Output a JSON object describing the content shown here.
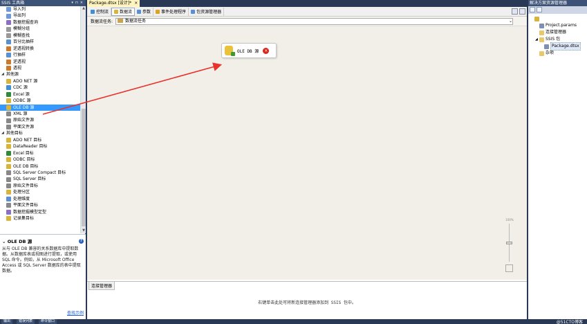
{
  "toolbox": {
    "title": "SSIS 工具箱",
    "items": [
      {
        "type": "item",
        "label": "导入列",
        "icon": "import-column-icon",
        "color": "#6d9bd8"
      },
      {
        "type": "item",
        "label": "导出列",
        "icon": "export-column-icon",
        "color": "#6d9bd8"
      },
      {
        "type": "item",
        "label": "数据挖掘查询",
        "icon": "data-mining-query-icon",
        "color": "#8c6fc0"
      },
      {
        "type": "item",
        "label": "模糊分组",
        "icon": "fuzzy-grouping-icon",
        "color": "#999999"
      },
      {
        "type": "item",
        "label": "模糊查找",
        "icon": "fuzzy-lookup-icon",
        "color": "#999999"
      },
      {
        "type": "item",
        "label": "百分比抽样",
        "icon": "percentage-sampling-icon",
        "color": "#5a8fd0"
      },
      {
        "type": "item",
        "label": "逆透视转换",
        "icon": "unpivot-icon",
        "color": "#cc7a2a"
      },
      {
        "type": "item",
        "label": "行抽样",
        "icon": "row-sampling-icon",
        "color": "#5a8fd0"
      },
      {
        "type": "item",
        "label": "逆透视",
        "icon": "unpivot-icon",
        "color": "#cc7a2a"
      },
      {
        "type": "item",
        "label": "透视",
        "icon": "pivot-icon",
        "color": "#cc7a2a"
      },
      {
        "type": "group",
        "label": "其他源"
      },
      {
        "type": "item",
        "label": "ADO NET 源",
        "icon": "ado-net-source-icon",
        "color": "#d9b43a"
      },
      {
        "type": "item",
        "label": "CDC 源",
        "icon": "cdc-source-icon",
        "color": "#3f8fd2"
      },
      {
        "type": "item",
        "label": "Excel 源",
        "icon": "excel-source-icon",
        "color": "#2f8a3a"
      },
      {
        "type": "item",
        "label": "ODBC 源",
        "icon": "odbc-source-icon",
        "color": "#d9b43a"
      },
      {
        "type": "item",
        "label": "OLE DB 源",
        "icon": "ole-db-source-icon",
        "color": "#d9b43a",
        "selected": true
      },
      {
        "type": "item",
        "label": "XML 源",
        "icon": "xml-source-icon",
        "color": "#888888"
      },
      {
        "type": "item",
        "label": "原始文件源",
        "icon": "raw-file-source-icon",
        "color": "#888888"
      },
      {
        "type": "item",
        "label": "平面文件源",
        "icon": "flat-file-source-icon",
        "color": "#888888"
      },
      {
        "type": "group",
        "label": "其他目标"
      },
      {
        "type": "item",
        "label": "ADO NET 目标",
        "icon": "ado-net-destination-icon",
        "color": "#d9b43a"
      },
      {
        "type": "item",
        "label": "DataReader 目标",
        "icon": "datareader-destination-icon",
        "color": "#d9b43a"
      },
      {
        "type": "item",
        "label": "Excel 目标",
        "icon": "excel-destination-icon",
        "color": "#2f8a3a"
      },
      {
        "type": "item",
        "label": "ODBC 目标",
        "icon": "odbc-destination-icon",
        "color": "#d9b43a"
      },
      {
        "type": "item",
        "label": "OLE DB 目标",
        "icon": "ole-db-destination-icon",
        "color": "#d9b43a"
      },
      {
        "type": "item",
        "label": "SQL Server Compact 目标",
        "icon": "sql-compact-destination-icon",
        "color": "#888888"
      },
      {
        "type": "item",
        "label": "SQL Server 目标",
        "icon": "sql-server-destination-icon",
        "color": "#888888"
      },
      {
        "type": "item",
        "label": "原始文件目标",
        "icon": "raw-file-destination-icon",
        "color": "#888888"
      },
      {
        "type": "item",
        "label": "处理分区",
        "icon": "partition-processing-icon",
        "color": "#d9b43a"
      },
      {
        "type": "item",
        "label": "处理维度",
        "icon": "dimension-processing-icon",
        "color": "#5a8fd0"
      },
      {
        "type": "item",
        "label": "平面文件目标",
        "icon": "flat-file-destination-icon",
        "color": "#888888"
      },
      {
        "type": "item",
        "label": "数据挖掘模型定型",
        "icon": "data-mining-training-icon",
        "color": "#8c6fc0"
      },
      {
        "type": "item",
        "label": "记录集目标",
        "icon": "recordset-destination-icon",
        "color": "#d9b43a"
      }
    ],
    "description": {
      "title": "OLE DB 源",
      "text": "从与 OLE DB 兼容的关系数据库中提取数据。从数据库表或视图进行提取，或使用 SQL 命令。例如，从 Microsoft Office Access 或 SQL Server 数据库的表中提取数据。",
      "link": "查找示例"
    }
  },
  "bottom_tabs": [
    "输出",
    "错误列表",
    "命令窗口"
  ],
  "designer": {
    "doc_tab": "Package.dtsx [设计]*",
    "tabs": [
      {
        "label": "控制流",
        "icon": "control-flow-icon",
        "color": "#3f8fd2"
      },
      {
        "label": "数据流",
        "icon": "data-flow-icon",
        "color": "#d9b43a",
        "active": true
      },
      {
        "label": "参数",
        "icon": "parameters-icon",
        "color": "#5a8fd0"
      },
      {
        "label": "事件处理程序",
        "icon": "event-handlers-icon",
        "color": "#e0a020"
      },
      {
        "label": "包资源管理器",
        "icon": "package-explorer-icon",
        "color": "#5a8fd0"
      }
    ],
    "task_label": "数据流任务:",
    "task_value": "数据流任务",
    "component_name": "OLE DB 源",
    "zoom_label": "100%",
    "connection_tab": "连接管理器",
    "connection_hint": "右键单击此处可将新连接管理器添加到 SSIS 包中。"
  },
  "solution": {
    "title": "解决方案资源管理器",
    "tree": [
      {
        "label": "",
        "indent": 0,
        "icon": "solution-icon",
        "color": "#d9b43a"
      },
      {
        "label": "Project.params",
        "indent": 1,
        "icon": "params-file-icon",
        "color": "#7f8fb0"
      },
      {
        "label": "连接管理器",
        "indent": 1,
        "icon": "folder-icon",
        "color": "#e8c86a"
      },
      {
        "label": "SSIS 包",
        "indent": 1,
        "icon": "folder-icon",
        "color": "#e8c86a",
        "expanded": true
      },
      {
        "label": "Package.dtsx",
        "indent": 2,
        "icon": "package-file-icon",
        "color": "#7f8fb0",
        "selected": true
      },
      {
        "label": "杂项",
        "indent": 1,
        "icon": "folder-icon",
        "color": "#e8c86a"
      }
    ]
  },
  "watermark": "@51CTO博客",
  "colors": {
    "frame": "#293955",
    "panel_title": "#3d5277",
    "selection": "#3399ff",
    "canvas": "#f1efe8",
    "arrow": "#e8322b"
  }
}
